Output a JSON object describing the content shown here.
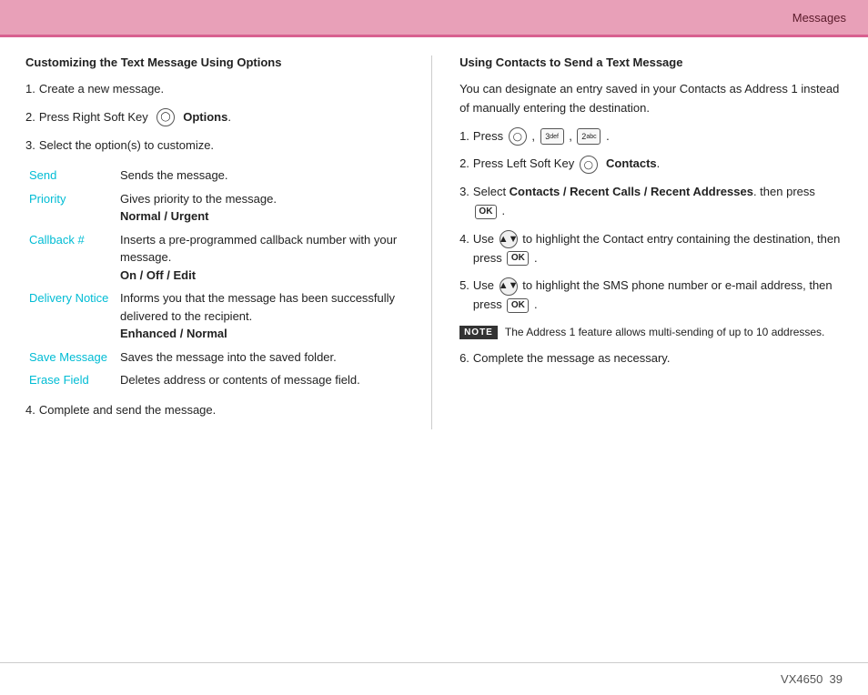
{
  "header": {
    "title": "Messages"
  },
  "footer": {
    "model": "VX4650",
    "page": "39"
  },
  "left": {
    "section_title": "Customizing the Text Message Using Options",
    "steps": [
      {
        "num": "1.",
        "text": "Create a new message."
      },
      {
        "num": "2.",
        "text_before": "Press Right Soft Key",
        "text_bold": "Options",
        "has_icon": true,
        "icon": "options-icon"
      },
      {
        "num": "3.",
        "text": "Select the option(s) to customize."
      }
    ],
    "options": [
      {
        "name": "Send",
        "description": "Sends the message."
      },
      {
        "name": "Priority",
        "description": "Gives priority to the message.",
        "bold": "Normal / Urgent"
      },
      {
        "name": "Callback #",
        "description": "Inserts a pre-programmed callback number with your message.",
        "bold": "On / Off / Edit"
      },
      {
        "name": "Delivery Notice",
        "description": "Informs you that the message has been successfully delivered to the recipient.",
        "bold": "Enhanced / Normal"
      },
      {
        "name": "Save Message",
        "description": "Saves the message into the saved folder."
      },
      {
        "name": "Erase Field",
        "description": "Deletes address or contents of message field."
      }
    ],
    "step4": {
      "num": "4.",
      "text": "Complete and send the message."
    }
  },
  "right": {
    "section_title": "Using Contacts to Send a Text Message",
    "intro": "You can designate an entry saved in your Contacts as Address 1 instead of manually entering the destination.",
    "steps": [
      {
        "num": "1.",
        "text": "Press",
        "has_icons": true
      },
      {
        "num": "2.",
        "text_before": "Press Left Soft Key",
        "text_bold": "Contacts",
        "has_icon": true
      },
      {
        "num": "3.",
        "text_before": "Select",
        "text_bold": "Contacts / Recent Calls / Recent Addresses",
        "text_after": "then press",
        "has_ok": true
      },
      {
        "num": "4.",
        "text_before": "Use",
        "text_middle": "to highlight the Contact entry containing the destination, then press",
        "has_nav": true,
        "has_ok": true
      },
      {
        "num": "5.",
        "text_before": "Use",
        "text_middle": "to highlight the SMS phone number or e-mail address, then press",
        "has_nav": true,
        "has_ok": true
      }
    ],
    "note": {
      "label": "NOTE",
      "text": "The Address 1 feature allows multi-sending of up to 10 addresses."
    },
    "step6": {
      "num": "6.",
      "text": "Complete the message as necessary."
    }
  }
}
